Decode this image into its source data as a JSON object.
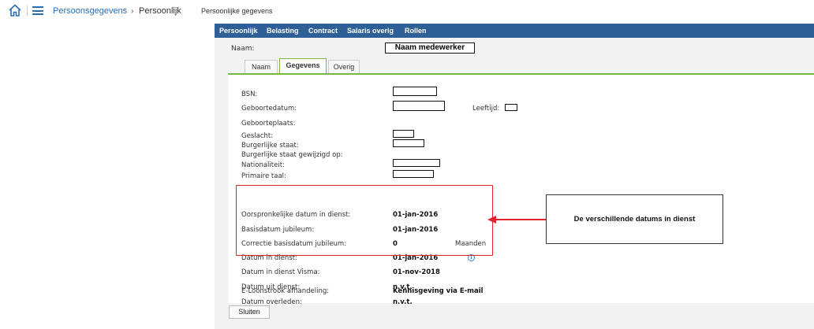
{
  "header": {
    "breadcrumb_section": "Persoonsgegevens",
    "breadcrumb_separator": "›",
    "breadcrumb_current": "Persoonlijk",
    "page_subtitle": "Persoonlijke gegevens",
    "home_icon": "home-icon",
    "menu_icon": "hamburger-menu-icon"
  },
  "navbar": {
    "items": [
      "Persoonlijk",
      "Belasting",
      "Contract",
      "Salaris overig",
      "Rollen"
    ]
  },
  "employee": {
    "naam_label": "Naam:",
    "naam_value": "Naam medewerker"
  },
  "tabs": {
    "items": [
      "Naam",
      "Gegevens",
      "Overig"
    ],
    "active": "Gegevens"
  },
  "fields": {
    "bsn": "BSN:",
    "geboortedatum": "Geboortedatum:",
    "leeftijd": "Leeftijd:",
    "geboorteplaats": "Geboorteplaats:",
    "geslacht": "Geslacht:",
    "burgerlijke_staat": "Burgerlijke staat:",
    "burgerlijke_staat_gewijzigd": "Burgerlijke staat gewijzigd op:",
    "nationaliteit": "Nationaliteit:",
    "primaire_taal": "Primaire taal:"
  },
  "dates": {
    "oorspronkelijke_label": "Oorspronkelijke datum in dienst:",
    "oorspronkelijke_value": "01-jan-2016",
    "basisdatum_label": "Basisdatum jubileum:",
    "basisdatum_value": "01-jan-2016",
    "correctie_label": "Correctie basisdatum jubileum:",
    "correctie_value": "0",
    "correctie_unit": "Maanden",
    "in_dienst_label": "Datum in dienst:",
    "in_dienst_value": "01-jan-2016",
    "in_dienst_visma_label": "Datum in dienst Visma:",
    "in_dienst_visma_value": "01-nov-2018",
    "uit_dienst_label": "Datum uit dienst:",
    "uit_dienst_value": "n.v.t.",
    "overleden_label": "Datum overleden:",
    "overleden_value": "n.v.t.",
    "eloonstrook_label": "E-Loonstrook afhandeling:",
    "eloonstrook_value": "Kennisgeving via E-mail"
  },
  "annotation": {
    "callout_text": "De verschillende datums in dienst",
    "highlight_color": "#e0262b"
  },
  "actions": {
    "close_label": "Sluiten"
  },
  "colors": {
    "accent": "#2f5f97",
    "tab_active_border": "#7ab648",
    "link": "#2a6fb3"
  }
}
